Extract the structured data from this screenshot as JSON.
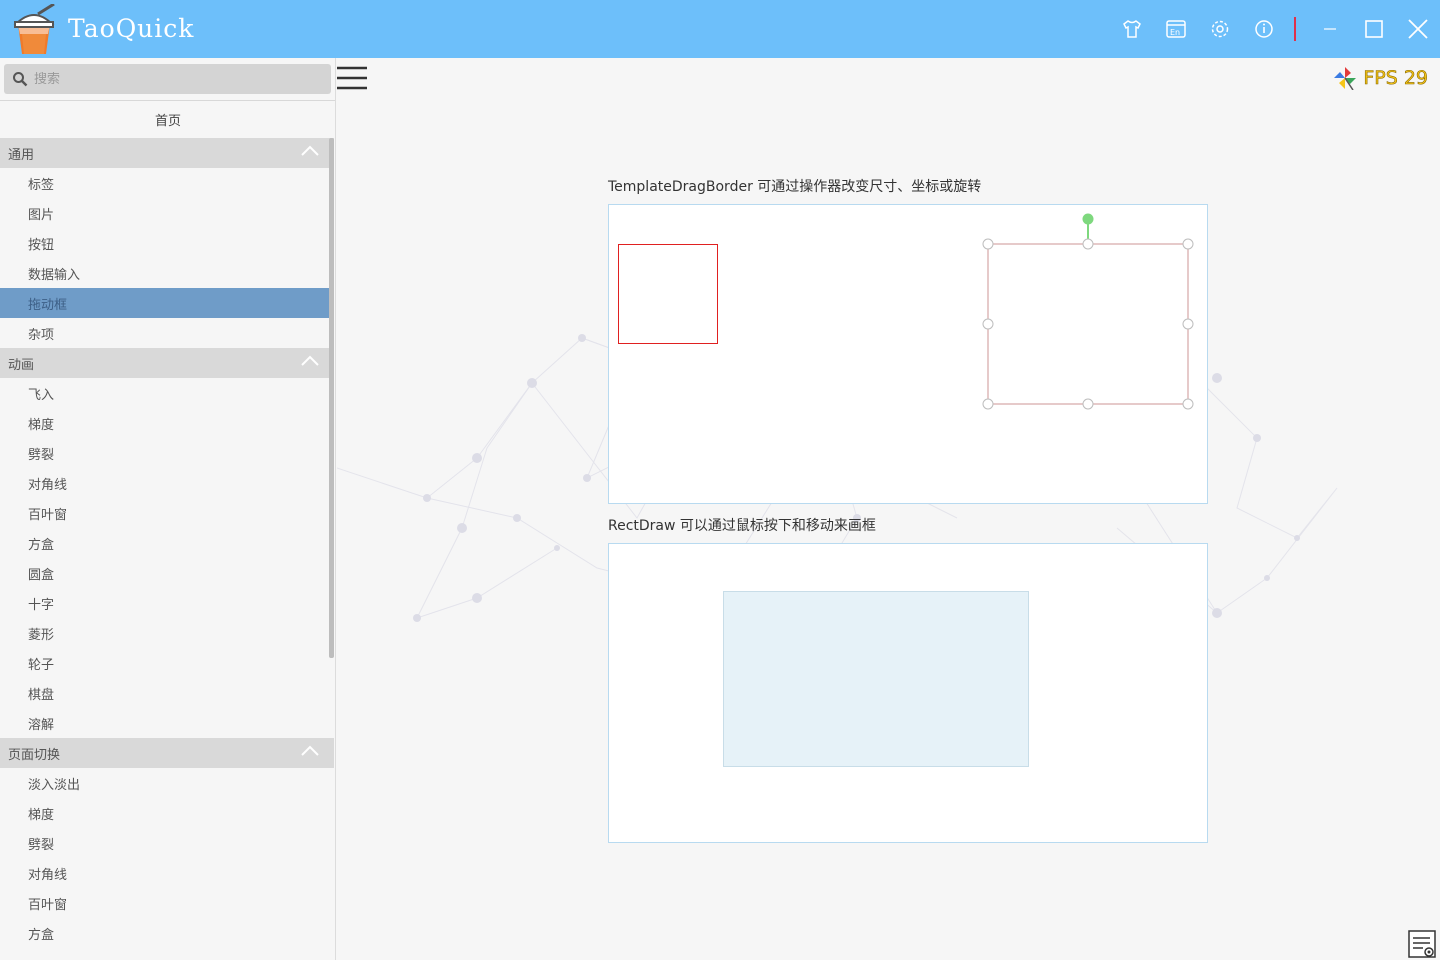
{
  "app": {
    "title": "TaoQuick"
  },
  "titlebar_icons": [
    "shirt-icon",
    "language-icon",
    "settings-icon",
    "info-icon",
    "minimize-icon",
    "maximize-icon",
    "close-icon"
  ],
  "search": {
    "placeholder": "搜索",
    "value": ""
  },
  "home_label": "首页",
  "sidebar": {
    "groups": [
      {
        "title": "通用",
        "expanded": true,
        "items": [
          "标签",
          "图片",
          "按钮",
          "数据输入",
          "拖动框",
          "杂项"
        ],
        "active_index": 4
      },
      {
        "title": "动画",
        "expanded": true,
        "items": [
          "飞入",
          "梯度",
          "劈裂",
          "对角线",
          "百叶窗",
          "方盒",
          "圆盒",
          "十字",
          "菱形",
          "轮子",
          "棋盘",
          "溶解"
        ]
      },
      {
        "title": "页面切换",
        "expanded": true,
        "items": [
          "淡入淡出",
          "梯度",
          "劈裂",
          "对角线",
          "百叶窗",
          "方盒"
        ]
      }
    ]
  },
  "fps": {
    "label": "FPS 29"
  },
  "demo1": {
    "label": "TemplateDragBorder 可通过操作器改变尺寸、坐标或旋转"
  },
  "demo2": {
    "label": "RectDraw 可以通过鼠标按下和移动来画框"
  },
  "colors": {
    "titlebar": "#6dbffa",
    "active_item": "#6f9cc8",
    "red_rect": "#e02020",
    "handle_green": "#7ed87e",
    "draw_fill": "#e6f2f8"
  }
}
